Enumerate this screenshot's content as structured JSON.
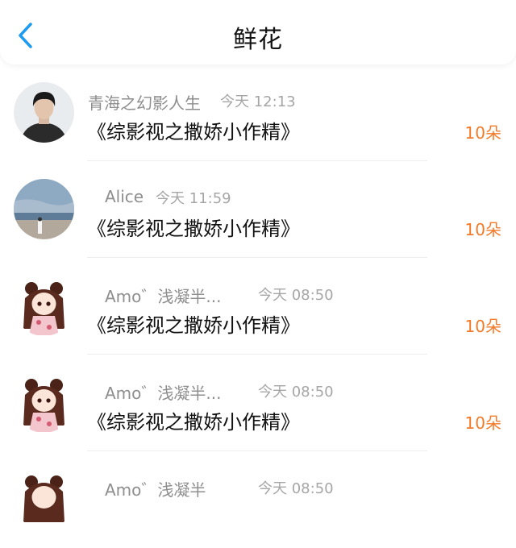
{
  "header": {
    "title": "鲜花",
    "back_icon": "chevron-left-icon"
  },
  "colors": {
    "accent_blue": "#1d9bf0",
    "count_orange": "#f47a28"
  },
  "items": [
    {
      "name": "青海之幻影人生",
      "time": "今天 12:13",
      "book": "《综影视之撒娇小作精》",
      "count": "10朵",
      "avatar": "avatar-man"
    },
    {
      "name": "Alice",
      "time": "今天 11:59",
      "book": "《综影视之撒娇小作精》",
      "count": "10朵",
      "avatar": "avatar-beach"
    },
    {
      "name": "Amo゛浅凝半...",
      "time": "今天 08:50",
      "book": "《综影视之撒娇小作精》",
      "count": "10朵",
      "avatar": "avatar-anime-girl"
    },
    {
      "name": "Amo゛浅凝半...",
      "time": "今天 08:50",
      "book": "《综影视之撒娇小作精》",
      "count": "10朵",
      "avatar": "avatar-anime-girl"
    },
    {
      "name": "Amo゛浅凝半",
      "time": "今天 08:50",
      "book": "",
      "count": "",
      "avatar": "avatar-anime-girl"
    }
  ]
}
